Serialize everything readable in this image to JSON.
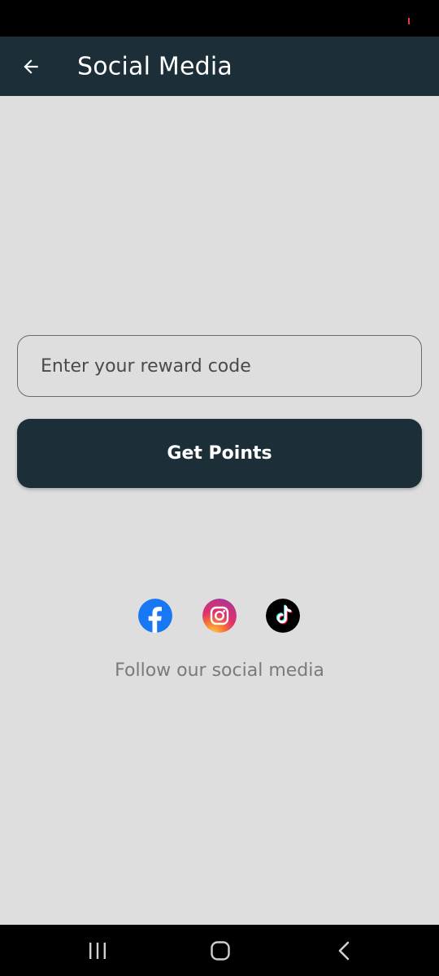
{
  "app_bar": {
    "title": "Social Media",
    "back_icon": "arrow-left-icon",
    "background": "#1c2f38"
  },
  "reward": {
    "placeholder": "Enter your reward code",
    "value": ""
  },
  "get_points": {
    "label": "Get Points"
  },
  "social": {
    "icons": [
      "facebook-icon",
      "instagram-icon",
      "tiktok-icon"
    ],
    "follow_text": "Follow our social media"
  },
  "nav": {
    "icons": [
      "recent-apps-icon",
      "home-icon",
      "back-icon"
    ]
  },
  "colors": {
    "primary": "#1c2f38",
    "background": "#dedede",
    "facebook": "#1877f2"
  }
}
